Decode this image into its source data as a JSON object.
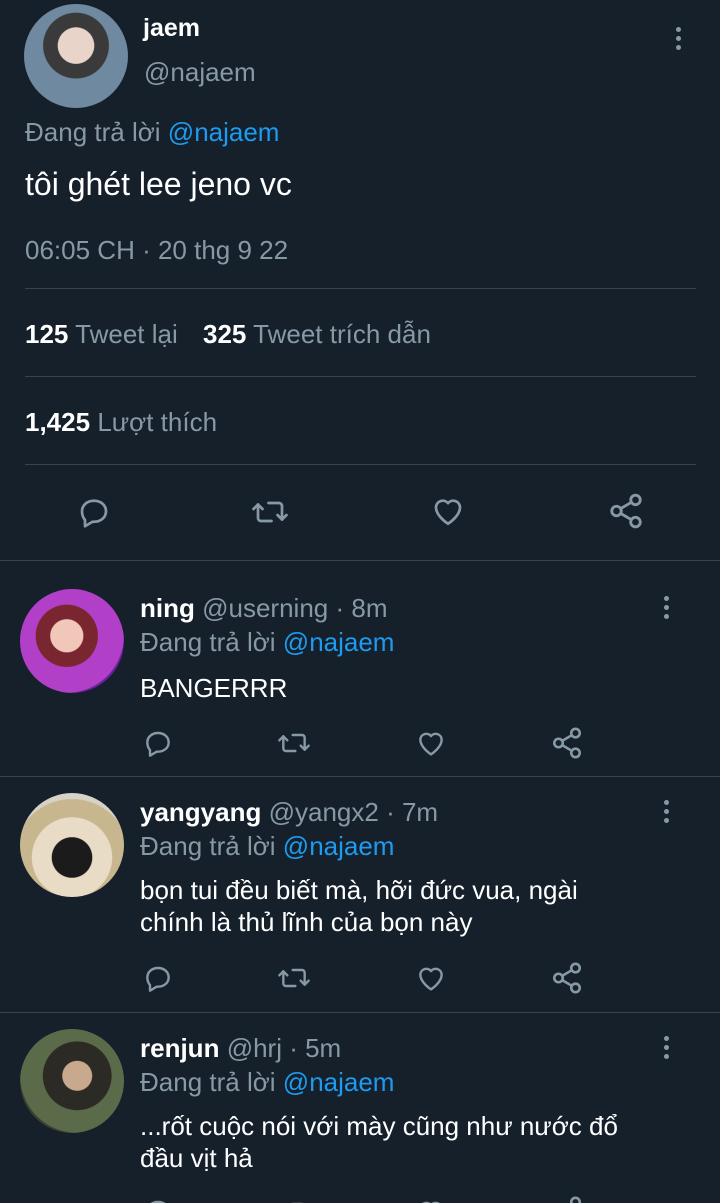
{
  "main_tweet": {
    "display_name": "jaem",
    "handle": "@najaem",
    "replying_prefix": "Đang trả lời",
    "replying_to": "@najaem",
    "text": "tôi ghét lee jeno vc",
    "timestamp": "06:05 CH · 20 thg 9 22",
    "retweets_count": "125",
    "retweets_label": "Tweet lại",
    "quotes_count": "325",
    "quotes_label": "Tweet trích dẫn",
    "likes_count": "1,425",
    "likes_label": "Lượt thích"
  },
  "replies": [
    {
      "display_name": "ning",
      "handle": "@userning",
      "time": "· 8m",
      "replying_prefix": "Đang trả lời",
      "replying_to": "@najaem",
      "text_lines": [
        "BANGERRR"
      ]
    },
    {
      "display_name": "yangyang",
      "handle": "@yangx2",
      "time": "· 7m",
      "replying_prefix": "Đang trả lời",
      "replying_to": "@najaem",
      "text_lines": [
        "bọn tui đều biết mà, hỡi đức vua, ngài",
        "chính là thủ lĩnh của bọn này"
      ]
    },
    {
      "display_name": "renjun",
      "handle": "@hrj",
      "time": "· 5m",
      "replying_prefix": "Đang trả lời",
      "replying_to": "@najaem",
      "text_lines": [
        "...rốt cuộc nói với mày cũng như nước đổ",
        "đầu vịt hả"
      ]
    }
  ],
  "icons": {
    "reply": "reply-icon",
    "retweet": "retweet-icon",
    "like": "heart-icon",
    "share": "share-icon",
    "more": "more-vertical-icon"
  },
  "colors": {
    "background": "#15202b",
    "divider": "#38444d",
    "muted": "#8899a6",
    "link": "#1d9bf0",
    "text": "#ffffff"
  }
}
